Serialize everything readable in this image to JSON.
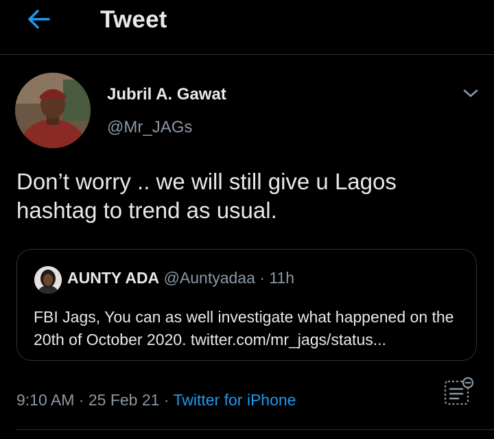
{
  "header": {
    "title": "Tweet",
    "back_icon": "arrow-left-icon",
    "accent_color": "#1d9bf0"
  },
  "tweet": {
    "author_name": "Jubril A. Gawat",
    "author_handle": "@Mr_JAGs",
    "menu_icon": "chevron-down-icon",
    "text": "Don’t worry .. we will still give u Lagos hashtag to trend as usual."
  },
  "quoted_tweet": {
    "author_name": "AUNTY ADA",
    "author_meta": "@Auntyadaa · 11h",
    "text": "FBI Jags, You can as well investigate what happened on the 20th of October 2020. twitter.com/mr_jags/status..."
  },
  "meta": {
    "time": "9:10 AM",
    "separator": "·",
    "date": "25 Feb 21",
    "source": "Twitter for iPhone",
    "analytics_icon": "analytics-icon"
  }
}
